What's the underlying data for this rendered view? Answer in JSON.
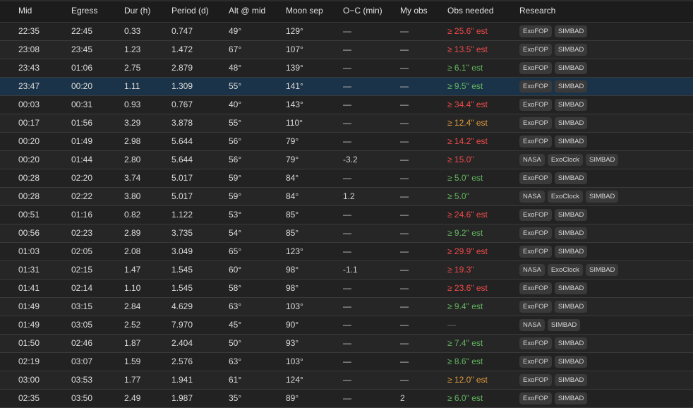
{
  "headers": [
    "Mid",
    "Egress",
    "Dur (h)",
    "Period (d)",
    "Alt @ mid",
    "Moon sep",
    "O−C (min)",
    "My obs",
    "Obs needed",
    "Research"
  ],
  "colors": {
    "red": "#ef4a4a",
    "orange": "#e09a3c",
    "green": "#62b65e",
    "selected_row": "#1b3348"
  },
  "rows": [
    {
      "mid": "22:35",
      "egress": "22:45",
      "dur": "0.33",
      "period": "0.747",
      "alt": "49°",
      "moon": "129°",
      "oc": "—",
      "myobs": "—",
      "obs": "≥ 25.6\" est",
      "obs_color": "red",
      "links": [
        "ExoFOP",
        "SIMBAD"
      ]
    },
    {
      "mid": "23:08",
      "egress": "23:45",
      "dur": "1.23",
      "period": "1.472",
      "alt": "67°",
      "moon": "107°",
      "oc": "—",
      "myobs": "—",
      "obs": "≥ 13.5\" est",
      "obs_color": "red",
      "links": [
        "ExoFOP",
        "SIMBAD"
      ]
    },
    {
      "mid": "23:43",
      "egress": "01:06",
      "dur": "2.75",
      "period": "2.879",
      "alt": "48°",
      "moon": "139°",
      "oc": "—",
      "myobs": "—",
      "obs": "≥ 6.1\" est",
      "obs_color": "green",
      "links": [
        "ExoFOP",
        "SIMBAD"
      ]
    },
    {
      "mid": "23:47",
      "egress": "00:20",
      "dur": "1.11",
      "period": "1.309",
      "alt": "55°",
      "moon": "141°",
      "oc": "—",
      "myobs": "—",
      "obs": "≥ 9.5\" est",
      "obs_color": "green",
      "links": [
        "ExoFOP",
        "SIMBAD"
      ],
      "selected": true
    },
    {
      "mid": "00:03",
      "egress": "00:31",
      "dur": "0.93",
      "period": "0.767",
      "alt": "40°",
      "moon": "143°",
      "oc": "—",
      "myobs": "—",
      "obs": "≥ 34.4\" est",
      "obs_color": "red",
      "links": [
        "ExoFOP",
        "SIMBAD"
      ]
    },
    {
      "mid": "00:17",
      "egress": "01:56",
      "dur": "3.29",
      "period": "3.878",
      "alt": "55°",
      "moon": "110°",
      "oc": "—",
      "myobs": "—",
      "obs": "≥ 12.4\" est",
      "obs_color": "orange",
      "links": [
        "ExoFOP",
        "SIMBAD"
      ]
    },
    {
      "mid": "00:20",
      "egress": "01:49",
      "dur": "2.98",
      "period": "5.644",
      "alt": "56°",
      "moon": "79°",
      "oc": "—",
      "myobs": "—",
      "obs": "≥ 14.2\" est",
      "obs_color": "red",
      "links": [
        "ExoFOP",
        "SIMBAD"
      ]
    },
    {
      "mid": "00:20",
      "egress": "01:44",
      "dur": "2.80",
      "period": "5.644",
      "alt": "56°",
      "moon": "79°",
      "oc": "-3.2",
      "myobs": "—",
      "obs": "≥ 15.0\"",
      "obs_color": "red",
      "links": [
        "NASA",
        "ExoClock",
        "SIMBAD"
      ]
    },
    {
      "mid": "00:28",
      "egress": "02:20",
      "dur": "3.74",
      "period": "5.017",
      "alt": "59°",
      "moon": "84°",
      "oc": "—",
      "myobs": "—",
      "obs": "≥ 5.0\" est",
      "obs_color": "green",
      "links": [
        "ExoFOP",
        "SIMBAD"
      ]
    },
    {
      "mid": "00:28",
      "egress": "02:22",
      "dur": "3.80",
      "period": "5.017",
      "alt": "59°",
      "moon": "84°",
      "oc": "1.2",
      "myobs": "—",
      "obs": "≥ 5.0\"",
      "obs_color": "green",
      "links": [
        "NASA",
        "ExoClock",
        "SIMBAD"
      ]
    },
    {
      "mid": "00:51",
      "egress": "01:16",
      "dur": "0.82",
      "period": "1.122",
      "alt": "53°",
      "moon": "85°",
      "oc": "—",
      "myobs": "—",
      "obs": "≥ 24.6\" est",
      "obs_color": "red",
      "links": [
        "ExoFOP",
        "SIMBAD"
      ]
    },
    {
      "mid": "00:56",
      "egress": "02:23",
      "dur": "2.89",
      "period": "3.735",
      "alt": "54°",
      "moon": "85°",
      "oc": "—",
      "myobs": "—",
      "obs": "≥ 9.2\" est",
      "obs_color": "green",
      "links": [
        "ExoFOP",
        "SIMBAD"
      ]
    },
    {
      "mid": "01:03",
      "egress": "02:05",
      "dur": "2.08",
      "period": "3.049",
      "alt": "65°",
      "moon": "123°",
      "oc": "—",
      "myobs": "—",
      "obs": "≥ 29.9\" est",
      "obs_color": "red",
      "links": [
        "ExoFOP",
        "SIMBAD"
      ]
    },
    {
      "mid": "01:31",
      "egress": "02:15",
      "dur": "1.47",
      "period": "1.545",
      "alt": "60°",
      "moon": "98°",
      "oc": "-1.1",
      "myobs": "—",
      "obs": "≥ 19.3\"",
      "obs_color": "red",
      "links": [
        "NASA",
        "ExoClock",
        "SIMBAD"
      ]
    },
    {
      "mid": "01:41",
      "egress": "02:14",
      "dur": "1.10",
      "period": "1.545",
      "alt": "58°",
      "moon": "98°",
      "oc": "—",
      "myobs": "—",
      "obs": "≥ 23.6\" est",
      "obs_color": "red",
      "links": [
        "ExoFOP",
        "SIMBAD"
      ]
    },
    {
      "mid": "01:49",
      "egress": "03:15",
      "dur": "2.84",
      "period": "4.629",
      "alt": "63°",
      "moon": "103°",
      "oc": "—",
      "myobs": "—",
      "obs": "≥ 9.4\" est",
      "obs_color": "green",
      "links": [
        "ExoFOP",
        "SIMBAD"
      ]
    },
    {
      "mid": "01:49",
      "egress": "03:05",
      "dur": "2.52",
      "period": "7.970",
      "alt": "45°",
      "moon": "90°",
      "oc": "—",
      "myobs": "—",
      "obs": "—",
      "obs_color": "grey",
      "links": [
        "NASA",
        "SIMBAD"
      ]
    },
    {
      "mid": "01:50",
      "egress": "02:46",
      "dur": "1.87",
      "period": "2.404",
      "alt": "50°",
      "moon": "93°",
      "oc": "—",
      "myobs": "—",
      "obs": "≥ 7.4\" est",
      "obs_color": "green",
      "links": [
        "ExoFOP",
        "SIMBAD"
      ]
    },
    {
      "mid": "02:19",
      "egress": "03:07",
      "dur": "1.59",
      "period": "2.576",
      "alt": "63°",
      "moon": "103°",
      "oc": "—",
      "myobs": "—",
      "obs": "≥ 8.6\" est",
      "obs_color": "green",
      "links": [
        "ExoFOP",
        "SIMBAD"
      ]
    },
    {
      "mid": "03:00",
      "egress": "03:53",
      "dur": "1.77",
      "period": "1.941",
      "alt": "61°",
      "moon": "124°",
      "oc": "—",
      "myobs": "—",
      "obs": "≥ 12.0\" est",
      "obs_color": "orange",
      "links": [
        "ExoFOP",
        "SIMBAD"
      ]
    },
    {
      "mid": "02:35",
      "egress": "03:50",
      "dur": "2.49",
      "period": "1.987",
      "alt": "35°",
      "moon": "89°",
      "oc": "—",
      "myobs": "2",
      "obs": "≥ 6.0\" est",
      "obs_color": "green",
      "links": [
        "ExoFOP",
        "SIMBAD"
      ]
    }
  ]
}
